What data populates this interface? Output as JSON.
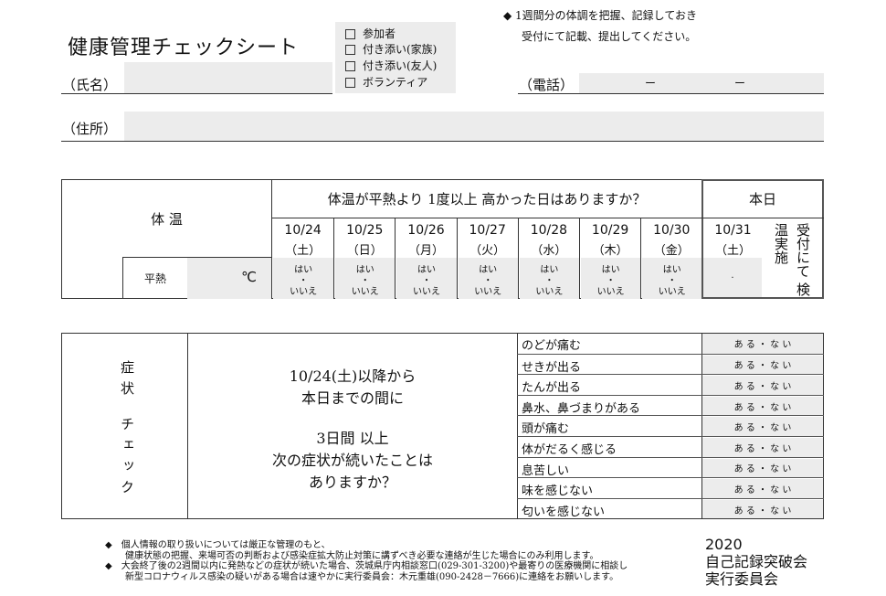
{
  "header": {
    "title": "健康管理チェックシート",
    "name_label": "（氏名）",
    "phone_label": "（電話）",
    "phone_sep1": "ー",
    "phone_sep2": "ー",
    "address_label": "（住所）"
  },
  "participant_types": [
    "参加者",
    "付き添い(家族)",
    "付き添い(友人)",
    "ボランティア"
  ],
  "instructions": {
    "line1": "◆ 1週間分の体調を把握、記録しておき",
    "line2": "受付にて記載、提出してください。"
  },
  "temperature": {
    "section_label": "体 温",
    "question": "体温が平熱より 1度以上 高かった日はありますか？",
    "today_label": "本日",
    "normal_label": "平熱",
    "unit": "℃",
    "days": [
      {
        "date": "10/24",
        "weekday": "（土）"
      },
      {
        "date": "10/25",
        "weekday": "（日）"
      },
      {
        "date": "10/26",
        "weekday": "（月）"
      },
      {
        "date": "10/27",
        "weekday": "（火）"
      },
      {
        "date": "10/28",
        "weekday": "（水）"
      },
      {
        "date": "10/29",
        "weekday": "（木）"
      },
      {
        "date": "10/30",
        "weekday": "（金）"
      }
    ],
    "today_date": "10/31",
    "today_weekday": "（土）",
    "answer_yes": "はい",
    "answer_dot": "・",
    "answer_no": "いいえ",
    "today_dot": ".",
    "check_note_col1": "受付にて",
    "check_note_col2": "検温実施"
  },
  "symptoms": {
    "section_label_1": "症状",
    "section_label_2": "チェック",
    "question_line1": "10/24(土)以降から",
    "question_line2": "本日までの間に",
    "question_line3": "3日間 以上",
    "question_line4": "次の症状が続いたことは",
    "question_line5": "ありますか？",
    "answer_text": "あ る ・ な い",
    "items": [
      "のどが痛む",
      "せきが出る",
      "たんが出る",
      "鼻水、鼻づまりがある",
      "頭が痛む",
      "体がだるく感じる",
      "息苦しい",
      "味を感じない",
      "匂いを感じない"
    ]
  },
  "footer": {
    "note1_line1": "◆　個人情報の取り扱いについては厳正な管理のもと、",
    "note1_line2": "健康状態の把握、来場可否の判断および感染症拡大防止対策に講ずべき必要な連絡が生じた場合にのみ利用します。",
    "note2_line1": "◆　大会終了後の2週間以内に発熱などの症状が続いた場合、茨城県庁内相談窓口(029-301-3200)や最寄りの医療機関に相談し",
    "note2_line2": "新型コロナウィルス感染の疑いがある場合は速やかに実行委員会：木元重雄(090-2428－7666)に連絡をお願いします。",
    "org_year": "2020",
    "org_line1": "自己記録突破会",
    "org_line2": "実行委員会"
  }
}
